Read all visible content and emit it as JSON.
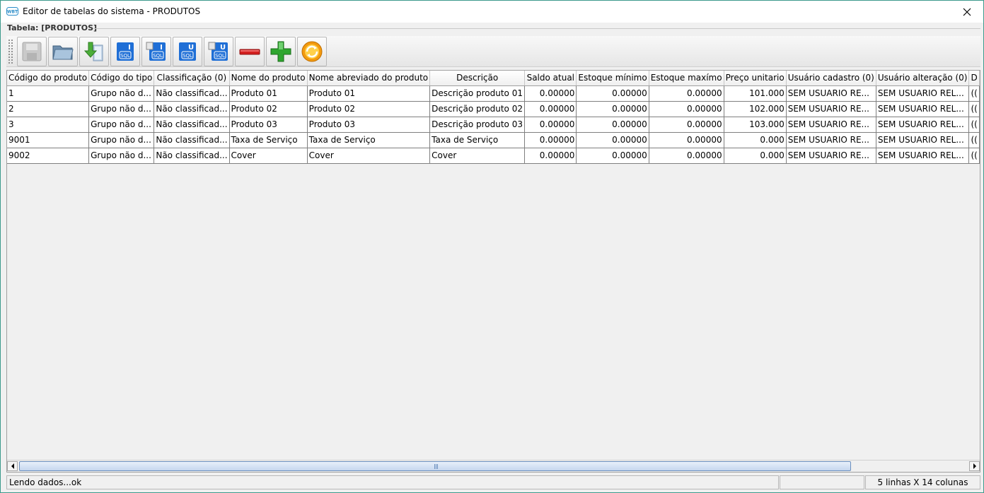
{
  "window": {
    "title": "Editor de tabelas do sistema - PRODUTOS",
    "icon": "app-logo-icon"
  },
  "group": {
    "label": "Tabela: [PRODUTOS]"
  },
  "toolbar": {
    "buttons": [
      {
        "icon": "save-icon",
        "enabled": false
      },
      {
        "icon": "open-folder-icon",
        "enabled": true
      },
      {
        "icon": "import-icon",
        "enabled": true
      },
      {
        "icon": "sql-insert-icon",
        "text": "I",
        "sub": "SQL",
        "enabled": true
      },
      {
        "icon": "sql-insert-file-icon",
        "text": "I",
        "sub": "SQL",
        "enabled": true
      },
      {
        "icon": "sql-update-icon",
        "text": "U",
        "sub": "SQL",
        "enabled": true
      },
      {
        "icon": "sql-update-file-icon",
        "text": "U",
        "sub": "SQL",
        "enabled": true
      },
      {
        "icon": "remove-row-icon",
        "enabled": true
      },
      {
        "icon": "add-row-icon",
        "enabled": true
      },
      {
        "icon": "refresh-icon",
        "enabled": true
      }
    ]
  },
  "table": {
    "columns": [
      "Código do produto",
      "Código do tipo",
      "Classificação (0)",
      "Nome do produto",
      "Nome abreviado do produto",
      "Descrição",
      "Saldo atual",
      "Estoque mínimo",
      "Estoque maxímo",
      "Preço unitario",
      "Usuário cadastro (0)",
      "Usuário alteração (0)",
      "D"
    ],
    "rows": [
      [
        "1",
        "Grupo não d...",
        "Não classificad...",
        "Produto 01",
        "Produto 01",
        "Descrição produto 01",
        "0.00000",
        "0.00000",
        "0.00000",
        "101.000",
        "SEM USUARIO RE...",
        "SEM USUARIO REL...",
        "(("
      ],
      [
        "2",
        "Grupo não d...",
        "Não classificad...",
        "Produto 02",
        "Produto 02",
        "Descrição produto 02",
        "0.00000",
        "0.00000",
        "0.00000",
        "102.000",
        "SEM USUARIO RE...",
        "SEM USUARIO REL...",
        "(("
      ],
      [
        "3",
        "Grupo não d...",
        "Não classificad...",
        "Produto 03",
        "Produto 03",
        "Descrição produto 03",
        "0.00000",
        "0.00000",
        "0.00000",
        "103.000",
        "SEM USUARIO RE...",
        "SEM USUARIO REL...",
        "(("
      ],
      [
        "9001",
        "Grupo não d...",
        "Não classificad...",
        "Taxa de Serviço",
        "Taxa de Serviço",
        "Taxa de Serviço",
        "0.00000",
        "0.00000",
        "0.00000",
        "0.000",
        "SEM USUARIO RE...",
        "SEM USUARIO REL...",
        "(("
      ],
      [
        "9002",
        "Grupo não d...",
        "Não classificad...",
        "Cover",
        "Cover",
        "Cover",
        "0.00000",
        "0.00000",
        "0.00000",
        "0.000",
        "SEM USUARIO RE...",
        "SEM USUARIO REL...",
        "(("
      ]
    ]
  },
  "status": {
    "message": "Lendo dados...ok",
    "summary": "5 linhas X 14 colunas"
  },
  "colors": {
    "window_border": "#3c9a8c",
    "sql_blue": "#1f6fd6",
    "minus_red": "#d42020",
    "plus_green": "#2fa62f",
    "refresh_orange": "#f39a0f"
  }
}
